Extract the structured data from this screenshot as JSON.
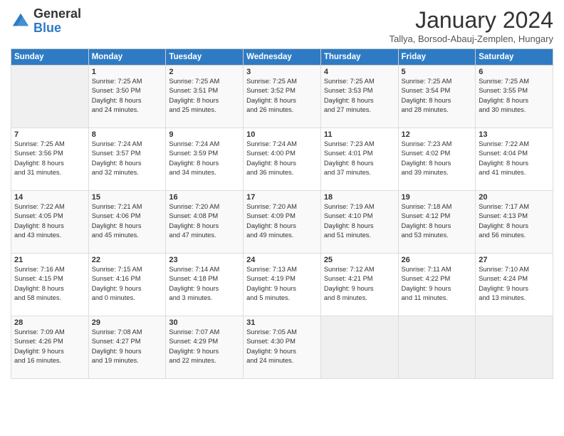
{
  "logo": {
    "general": "General",
    "blue": "Blue"
  },
  "header": {
    "title": "January 2024",
    "subtitle": "Tallya, Borsod-Abauj-Zemplen, Hungary"
  },
  "columns": [
    "Sunday",
    "Monday",
    "Tuesday",
    "Wednesday",
    "Thursday",
    "Friday",
    "Saturday"
  ],
  "weeks": [
    [
      {
        "num": "",
        "info": ""
      },
      {
        "num": "1",
        "info": "Sunrise: 7:25 AM\nSunset: 3:50 PM\nDaylight: 8 hours\nand 24 minutes."
      },
      {
        "num": "2",
        "info": "Sunrise: 7:25 AM\nSunset: 3:51 PM\nDaylight: 8 hours\nand 25 minutes."
      },
      {
        "num": "3",
        "info": "Sunrise: 7:25 AM\nSunset: 3:52 PM\nDaylight: 8 hours\nand 26 minutes."
      },
      {
        "num": "4",
        "info": "Sunrise: 7:25 AM\nSunset: 3:53 PM\nDaylight: 8 hours\nand 27 minutes."
      },
      {
        "num": "5",
        "info": "Sunrise: 7:25 AM\nSunset: 3:54 PM\nDaylight: 8 hours\nand 28 minutes."
      },
      {
        "num": "6",
        "info": "Sunrise: 7:25 AM\nSunset: 3:55 PM\nDaylight: 8 hours\nand 30 minutes."
      }
    ],
    [
      {
        "num": "7",
        "info": "Sunrise: 7:25 AM\nSunset: 3:56 PM\nDaylight: 8 hours\nand 31 minutes."
      },
      {
        "num": "8",
        "info": "Sunrise: 7:24 AM\nSunset: 3:57 PM\nDaylight: 8 hours\nand 32 minutes."
      },
      {
        "num": "9",
        "info": "Sunrise: 7:24 AM\nSunset: 3:59 PM\nDaylight: 8 hours\nand 34 minutes."
      },
      {
        "num": "10",
        "info": "Sunrise: 7:24 AM\nSunset: 4:00 PM\nDaylight: 8 hours\nand 36 minutes."
      },
      {
        "num": "11",
        "info": "Sunrise: 7:23 AM\nSunset: 4:01 PM\nDaylight: 8 hours\nand 37 minutes."
      },
      {
        "num": "12",
        "info": "Sunrise: 7:23 AM\nSunset: 4:02 PM\nDaylight: 8 hours\nand 39 minutes."
      },
      {
        "num": "13",
        "info": "Sunrise: 7:22 AM\nSunset: 4:04 PM\nDaylight: 8 hours\nand 41 minutes."
      }
    ],
    [
      {
        "num": "14",
        "info": "Sunrise: 7:22 AM\nSunset: 4:05 PM\nDaylight: 8 hours\nand 43 minutes."
      },
      {
        "num": "15",
        "info": "Sunrise: 7:21 AM\nSunset: 4:06 PM\nDaylight: 8 hours\nand 45 minutes."
      },
      {
        "num": "16",
        "info": "Sunrise: 7:20 AM\nSunset: 4:08 PM\nDaylight: 8 hours\nand 47 minutes."
      },
      {
        "num": "17",
        "info": "Sunrise: 7:20 AM\nSunset: 4:09 PM\nDaylight: 8 hours\nand 49 minutes."
      },
      {
        "num": "18",
        "info": "Sunrise: 7:19 AM\nSunset: 4:10 PM\nDaylight: 8 hours\nand 51 minutes."
      },
      {
        "num": "19",
        "info": "Sunrise: 7:18 AM\nSunset: 4:12 PM\nDaylight: 8 hours\nand 53 minutes."
      },
      {
        "num": "20",
        "info": "Sunrise: 7:17 AM\nSunset: 4:13 PM\nDaylight: 8 hours\nand 56 minutes."
      }
    ],
    [
      {
        "num": "21",
        "info": "Sunrise: 7:16 AM\nSunset: 4:15 PM\nDaylight: 8 hours\nand 58 minutes."
      },
      {
        "num": "22",
        "info": "Sunrise: 7:15 AM\nSunset: 4:16 PM\nDaylight: 9 hours\nand 0 minutes."
      },
      {
        "num": "23",
        "info": "Sunrise: 7:14 AM\nSunset: 4:18 PM\nDaylight: 9 hours\nand 3 minutes."
      },
      {
        "num": "24",
        "info": "Sunrise: 7:13 AM\nSunset: 4:19 PM\nDaylight: 9 hours\nand 5 minutes."
      },
      {
        "num": "25",
        "info": "Sunrise: 7:12 AM\nSunset: 4:21 PM\nDaylight: 9 hours\nand 8 minutes."
      },
      {
        "num": "26",
        "info": "Sunrise: 7:11 AM\nSunset: 4:22 PM\nDaylight: 9 hours\nand 11 minutes."
      },
      {
        "num": "27",
        "info": "Sunrise: 7:10 AM\nSunset: 4:24 PM\nDaylight: 9 hours\nand 13 minutes."
      }
    ],
    [
      {
        "num": "28",
        "info": "Sunrise: 7:09 AM\nSunset: 4:26 PM\nDaylight: 9 hours\nand 16 minutes."
      },
      {
        "num": "29",
        "info": "Sunrise: 7:08 AM\nSunset: 4:27 PM\nDaylight: 9 hours\nand 19 minutes."
      },
      {
        "num": "30",
        "info": "Sunrise: 7:07 AM\nSunset: 4:29 PM\nDaylight: 9 hours\nand 22 minutes."
      },
      {
        "num": "31",
        "info": "Sunrise: 7:05 AM\nSunset: 4:30 PM\nDaylight: 9 hours\nand 24 minutes."
      },
      {
        "num": "",
        "info": ""
      },
      {
        "num": "",
        "info": ""
      },
      {
        "num": "",
        "info": ""
      }
    ]
  ]
}
